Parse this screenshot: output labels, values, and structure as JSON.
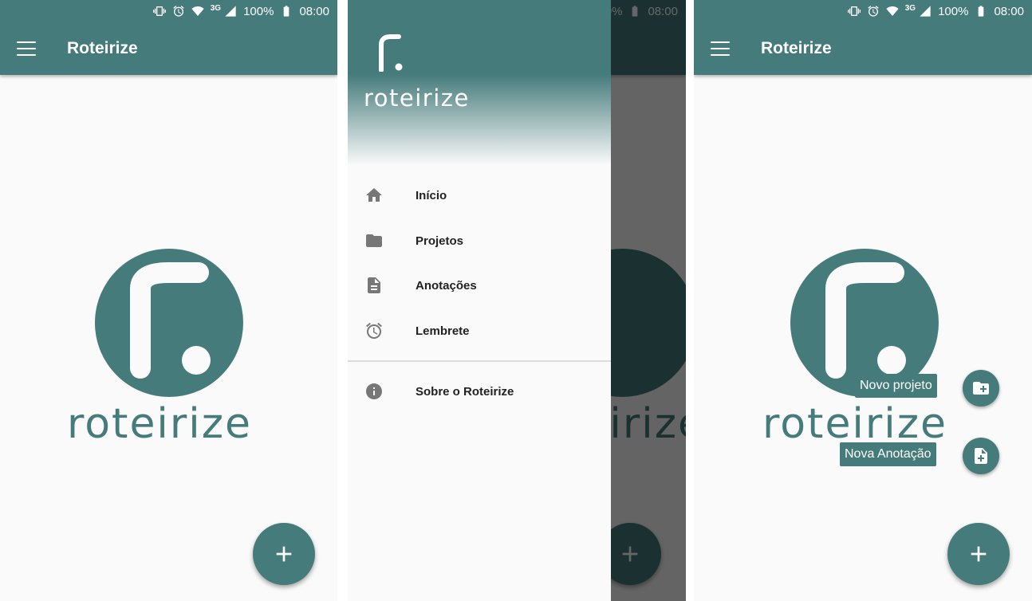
{
  "status_bar": {
    "network": "3G",
    "battery": "100%",
    "time": "08:00"
  },
  "app": {
    "title": "Roteirize",
    "logo_word": "roteirize"
  },
  "drawer": {
    "brand": "roteirize",
    "items": [
      {
        "label": "Início",
        "icon": "home-icon"
      },
      {
        "label": "Projetos",
        "icon": "folder-icon"
      },
      {
        "label": "Anotações",
        "icon": "document-icon"
      },
      {
        "label": "Lembrete",
        "icon": "alarm-icon"
      },
      {
        "label": "Sobre o Roteirize",
        "icon": "info-icon"
      }
    ]
  },
  "speed_dial": {
    "new_project": "Novo projeto",
    "new_note": "Nova Anotação"
  },
  "colors": {
    "primary": "#457b7b",
    "background": "#fafafa"
  }
}
